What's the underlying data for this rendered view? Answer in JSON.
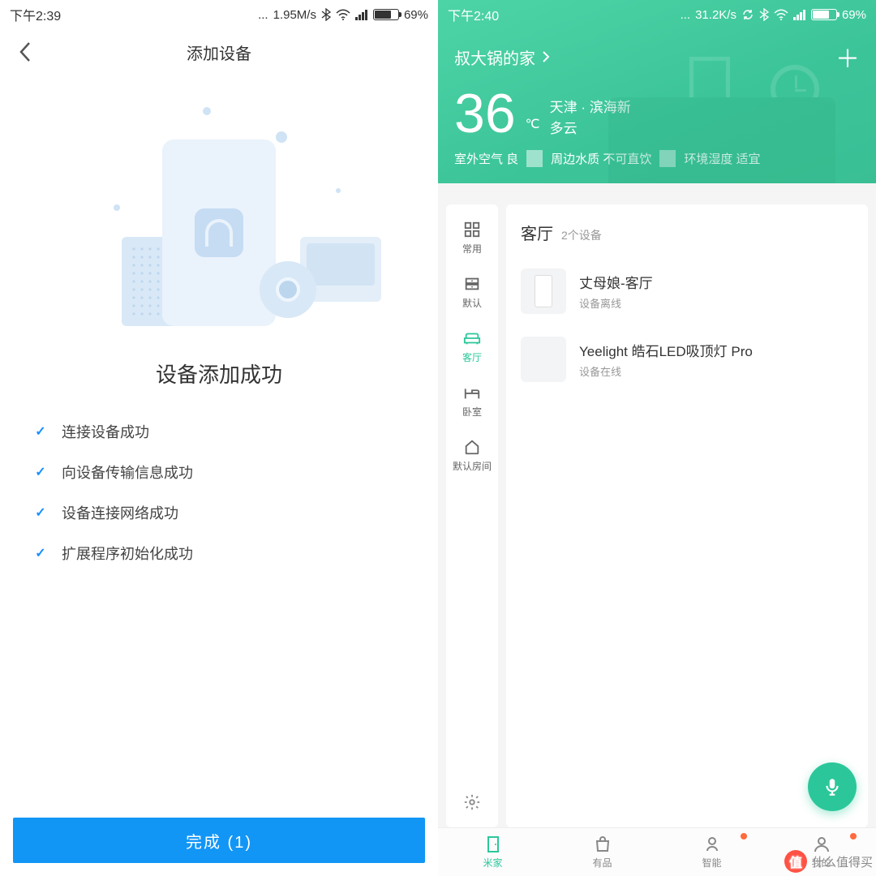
{
  "left": {
    "status": {
      "time": "下午2:39",
      "net_speed": "1.95M/s",
      "battery_pct": "69%"
    },
    "title": "添加设备",
    "success_title": "设备添加成功",
    "steps": [
      "连接设备成功",
      "向设备传输信息成功",
      "设备连接网络成功",
      "扩展程序初始化成功"
    ],
    "complete_button": "完成 (1)"
  },
  "right": {
    "status": {
      "time": "下午2:40",
      "net_speed": "31.2K/s",
      "battery_pct": "69%"
    },
    "home_name": "叔大锅的家",
    "weather": {
      "temp": "36",
      "unit": "℃",
      "location": "天津 · 滨海新",
      "condition": "多云",
      "air": "室外空气 良",
      "water": "周边水质 不可直饮",
      "humidity": "环境湿度 适宜"
    },
    "room_nav": {
      "items": [
        {
          "icon": "grid-icon",
          "label": "常用"
        },
        {
          "icon": "drawer-icon",
          "label": "默认"
        },
        {
          "icon": "sofa-icon",
          "label": "客厅"
        },
        {
          "icon": "bed-icon",
          "label": "卧室"
        },
        {
          "icon": "house-icon",
          "label": "默认房间"
        }
      ],
      "settings_label": ""
    },
    "room": {
      "title": "客厅",
      "count": "2个设备",
      "devices": [
        {
          "name": "丈母娘-客厅",
          "status": "设备离线"
        },
        {
          "name": "Yeelight 皓石LED吸顶灯 Pro",
          "status": "设备在线"
        }
      ]
    },
    "tabs": [
      {
        "label": "米家",
        "icon": "door-icon",
        "active": true,
        "dot": false
      },
      {
        "label": "有品",
        "icon": "bag-icon",
        "active": false,
        "dot": false
      },
      {
        "label": "智能",
        "icon": "chip-icon",
        "active": false,
        "dot": true
      },
      {
        "label": "我的",
        "icon": "person-icon",
        "active": false,
        "dot": true
      }
    ]
  },
  "watermark": "什么值得买"
}
